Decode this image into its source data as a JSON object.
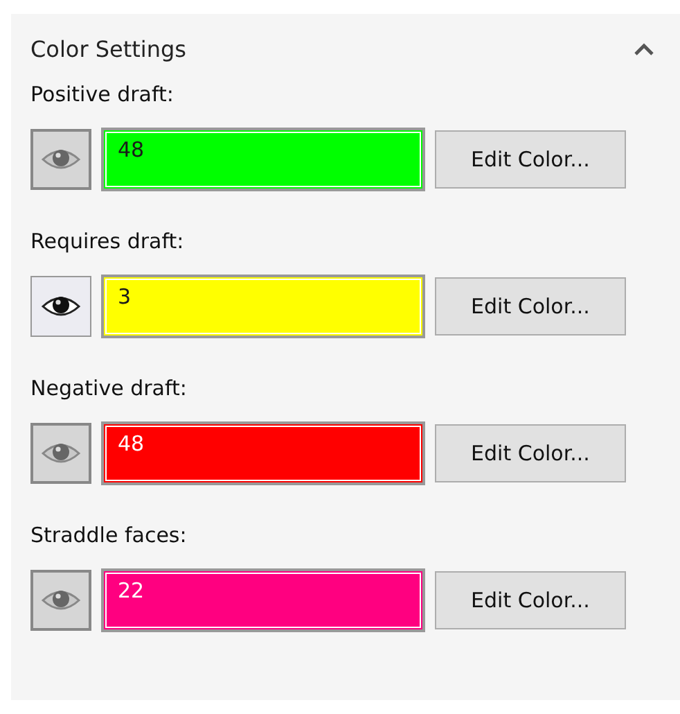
{
  "section": {
    "title": "Color Settings",
    "expanded": true
  },
  "items": [
    {
      "label": "Positive draft:",
      "pressed": true,
      "value": "48",
      "color": "#00ff00",
      "button": "Edit Color..."
    },
    {
      "label": "Requires draft:",
      "pressed": false,
      "value": "3",
      "color": "#ffff00",
      "button": "Edit Color..."
    },
    {
      "label": "Negative draft:",
      "pressed": true,
      "value": "48",
      "color": "#ff0000",
      "button": "Edit Color..."
    },
    {
      "label": "Straddle faces:",
      "pressed": true,
      "value": "22",
      "color": "#ff0080",
      "button": "Edit Color..."
    }
  ]
}
